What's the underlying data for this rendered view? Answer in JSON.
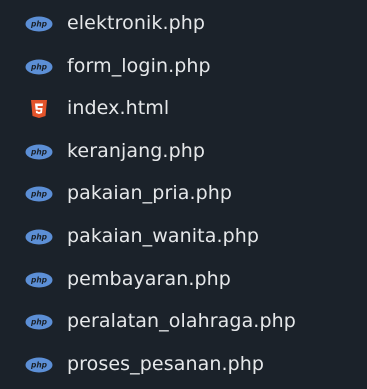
{
  "colors": {
    "background": "#1b222a",
    "text": "#e6e8ea",
    "php_icon": "#5c8fd6",
    "html_icon": "#e4542b"
  },
  "files": [
    {
      "name": "elektronik.php",
      "icon": "php-icon"
    },
    {
      "name": "form_login.php",
      "icon": "php-icon"
    },
    {
      "name": "index.html",
      "icon": "html5-icon"
    },
    {
      "name": "keranjang.php",
      "icon": "php-icon"
    },
    {
      "name": "pakaian_pria.php",
      "icon": "php-icon"
    },
    {
      "name": "pakaian_wanita.php",
      "icon": "php-icon"
    },
    {
      "name": "pembayaran.php",
      "icon": "php-icon"
    },
    {
      "name": "peralatan_olahraga.php",
      "icon": "php-icon"
    },
    {
      "name": "proses_pesanan.php",
      "icon": "php-icon"
    }
  ]
}
